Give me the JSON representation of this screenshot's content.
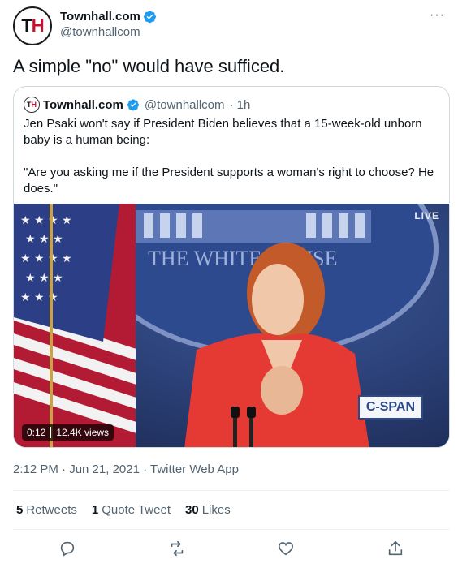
{
  "author": {
    "name": "Townhall.com",
    "handle": "@townhallcom",
    "avatar_text_t": "T",
    "avatar_text_h": "H"
  },
  "more_label": "···",
  "tweet": {
    "text": "A simple \"no\" would have sufficed."
  },
  "quoted": {
    "name": "Townhall.com",
    "handle": "@townhallcom",
    "time": "· 1h",
    "avatar_text_t": "T",
    "avatar_text_h": "H",
    "paragraph1": "Jen Psaki won't say if President Biden believes that a 15-week-old unborn baby is a human being:",
    "paragraph2": "\"Are you asking me if the President supports a woman's right to choose? He does.\"",
    "video": {
      "live_label": "LIVE",
      "network_logo": "C-SPAN",
      "seal_text": "THE WHITE HOUSE",
      "duration": "0:12",
      "views": "12.4K views"
    }
  },
  "timestamp": "2:12 PM · Jun 21, 2021 · Twitter Web App",
  "stats": {
    "retweets_count": "5",
    "retweets_label": "Retweets",
    "quotes_count": "1",
    "quotes_label": "Quote Tweet",
    "likes_count": "30",
    "likes_label": "Likes"
  },
  "colors": {
    "verified": "#1d9bf0",
    "brand_red": "#c8102e",
    "secondary_text": "#536471",
    "border": "#cfd9de"
  },
  "icons": [
    "verified-icon",
    "reply-icon",
    "retweet-icon",
    "like-icon",
    "share-icon",
    "more-icon"
  ]
}
